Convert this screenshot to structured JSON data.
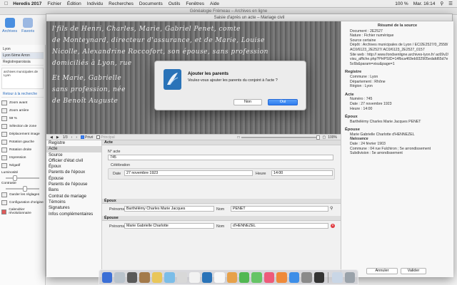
{
  "menubar": {
    "apple": "",
    "app": "Heredis 2017",
    "items": [
      "Fichier",
      "Édition",
      "Individu",
      "Recherches",
      "Documents",
      "Outils",
      "Fenêtres",
      "Aide"
    ],
    "time": "Mar. 16:14",
    "battery": "100 %"
  },
  "background": {
    "window_title": "Généalogie Frémeau – Archives en ligne",
    "toolbar": [
      "Archives",
      "Favoris"
    ],
    "location": "Lyon",
    "location_tab": "Lyon 6ème Arron",
    "registre": "Registreparoissia",
    "archive_label": "archives municipales de Lyon",
    "retour": "Retour à la recherche",
    "tools": [
      "Zoom avant",
      "Zoom arrière",
      "Sélection de zone",
      "Déplacement image",
      "Rotation gauche",
      "Rotation droite",
      "Impression",
      "Négatif",
      "Luminosité",
      "Contraste",
      "Garder les réglages",
      "Configuration d'origine",
      "Calendrier révolutionnaire"
    ],
    "zoom_value": "59 %"
  },
  "sheet": {
    "title": "Saisie d'après un acte – Mariage civil",
    "doc_lines": [
      "l'fils de Henri, Charles, Marie, Gabriel Penet, comte",
      "de Monteynard, directeur d'assurance, et de Marie, Louise",
      "Nicolle, Alexandrine Roccofort, son épouse, sans profession",
      "domiciliés à Lyon, rue",
      "Et Marie, Gabrielle",
      "sans profession, née",
      "de Benoît Auguste"
    ],
    "viewbar": {
      "page": "1/3",
      "prive": "Privé",
      "principal": "Principal",
      "zoom": "100%"
    }
  },
  "nav": {
    "items": [
      "Registre",
      "Acte",
      "Source",
      "Officier d'état civil",
      "Époux",
      "Parents de l'époux",
      "Épouse",
      "Parents de l'épouse",
      "Bans",
      "Contrat de mariage",
      "Témoins",
      "Signatures",
      "Infos complémentaires"
    ]
  },
  "form": {
    "acte_header": "Acte",
    "num_label": "N° acte",
    "num_value": "745",
    "celebration_label": "Célébration",
    "date_label": "Date",
    "date_value": "27 novembre 1923",
    "heure_label": "Heure",
    "heure_value": "14:00",
    "epoux_header": "Époux",
    "epoux_prenoms_label": "Prénoms",
    "epoux_prenoms": "Barthélémy Charles Marie Jacques",
    "epoux_nom_label": "Nom",
    "epoux_nom": "PENET",
    "epouse_header": "Épouse",
    "epouse_prenoms_label": "Prénoms",
    "epouse_prenoms": "Marie Gabrielle Charlotte",
    "epouse_nom_label": "Nom",
    "epouse_nom": "d'HENNEZEL",
    "cancel": "Annuler",
    "validate": "Valider"
  },
  "summary": {
    "header": "Résumé de la source",
    "document": "Document : 2E2527",
    "nature": "Nature : Fichier numérique",
    "certitude": "Source certaine",
    "depot": "Dépôt : Archives municipales de Lyon / EC/2E2527/0_2558/ AC0/6123_2E2527/ AC0/6123_2E2527_0157",
    "site": "Site web : http:// www.fondsenligne.archives-lyon.fr/ ac69v2/visu_affiche.php?PHPSID=14fbca469eb932905edafd65d7e5c6b&param=visu&page=1",
    "registre_h": "Registre",
    "commune": "Commune : Lyon",
    "departement": "Département : Rhône",
    "region": "Région : Lyon",
    "acte_h": "Acte",
    "numero": "Numéro : 745",
    "date": "Date : 27 novembre 1923",
    "heure": "Heure : 14:00",
    "epoux_h": "Époux",
    "epoux": "Barthélémy Charles Marie Jacques PENET",
    "epouse_h": "Épouse",
    "epouse": "Marie Gabrielle Charlotte d'HENNEZEL",
    "naissance_h": "Naissance",
    "naissance_date": "Date : 24 février 1903",
    "naissance_commune": "Commune : 04 rue Fulchiron ; 5e arrondissement",
    "naissance_subdiv": "Subdivision : 5e arrondissement"
  },
  "dialog": {
    "title": "Ajouter les parents",
    "message": "Voulez-vous ajouter les parents du conjoint à l'acte ?",
    "no": "Non",
    "yes": "Oui",
    "badge": "2017"
  },
  "colors": {
    "accent": "#2d7cf0",
    "sheet_bg": "#ececec",
    "summary_bg": "#f7f7f7"
  }
}
